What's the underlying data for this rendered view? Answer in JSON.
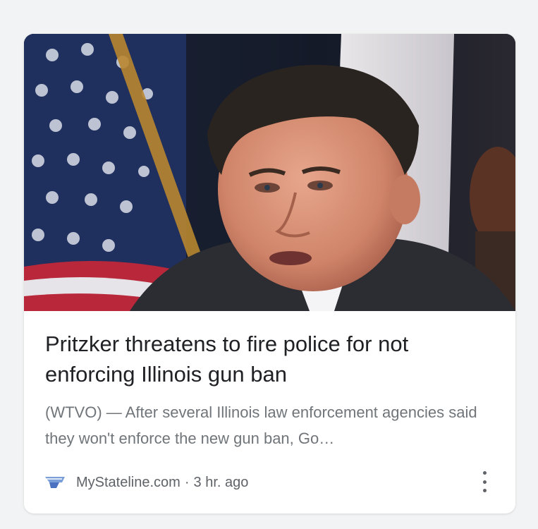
{
  "article": {
    "headline": "Pritzker threatens to fire police for not enforcing Illinois gun ban",
    "snippet": "(WTVO) — After several Illinois law enforcement agencies said they won't enforce the new gun ban, Go…",
    "source": "MyStateline.com",
    "separator": "·",
    "time": "3 hr. ago"
  },
  "icons": {
    "favicon": "mystateline-favicon",
    "more": "more-vert-icon"
  },
  "colors": {
    "headline": "#202124",
    "snippet": "#70757a",
    "meta": "#5f6368",
    "card": "#ffffff"
  }
}
